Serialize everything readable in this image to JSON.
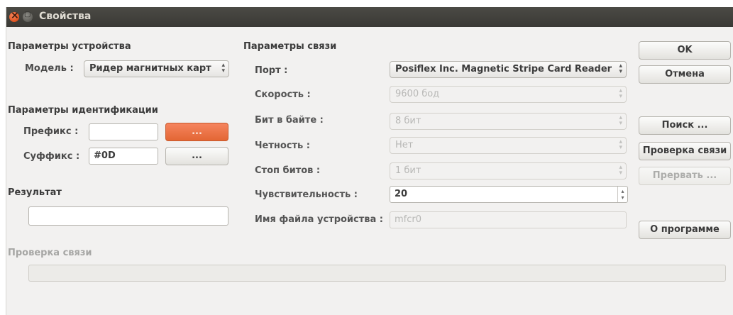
{
  "window": {
    "title": "Свойства"
  },
  "device": {
    "heading": "Параметры устройства",
    "model_label": "Модель :",
    "model_value": "Ридер магнитных карт"
  },
  "ident": {
    "heading": "Параметры идентификации",
    "prefix_label": "Префикс :",
    "prefix_value": "",
    "prefix_btn": "...",
    "suffix_label": "Суффикс :",
    "suffix_value": "#0D",
    "suffix_btn": "..."
  },
  "result": {
    "heading": "Результат",
    "value": ""
  },
  "comm": {
    "heading": "Параметры связи",
    "port_label": "Порт :",
    "port_value": "Posiflex Inc. Magnetic Stripe Card Reader",
    "speed_label": "Скорость :",
    "speed_value": "9600 бод",
    "bits_label": "Бит в байте :",
    "bits_value": "8 бит",
    "parity_label": "Четность :",
    "parity_value": "Нет",
    "stop_label": "Стоп битов :",
    "stop_value": "1 бит",
    "sens_label": "Чувствительность :",
    "sens_value": "20",
    "file_label": "Имя файла устройства :",
    "file_value": "mfcr0"
  },
  "check": {
    "heading": "Проверка связи",
    "progress": 0
  },
  "buttons": {
    "ok": "OK",
    "cancel": "Отмена",
    "search": "Поиск ...",
    "check": "Проверка связи",
    "abort": "Прервать ...",
    "about": "О программе"
  }
}
